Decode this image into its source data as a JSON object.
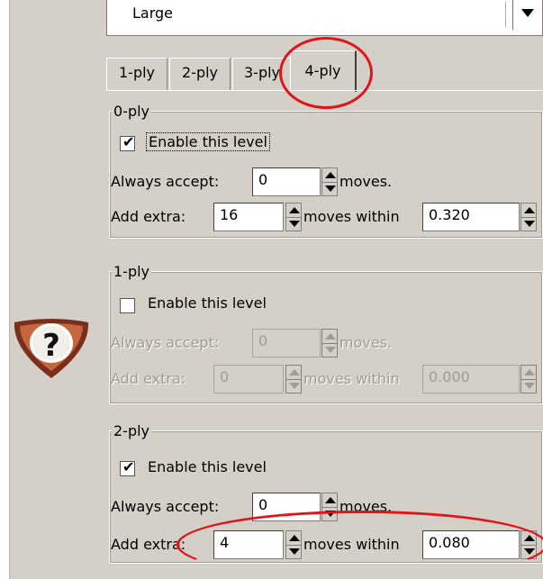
{
  "dropdown": {
    "value": "Large"
  },
  "tabs": [
    "1-ply",
    "2-ply",
    "3-ply",
    "4-ply"
  ],
  "groups": [
    {
      "legend": "0-ply",
      "enable_label": "Enable this level",
      "checked": true,
      "always_label": "Always accept:",
      "always_value": "0",
      "moves_label": "moves.",
      "extra_label": "Add extra:",
      "extra_value": "16",
      "within_label": "moves within",
      "within_value": "0.320"
    },
    {
      "legend": "1-ply",
      "enable_label": "Enable this level",
      "checked": false,
      "always_label": "Always accept:",
      "always_value": "0",
      "moves_label": "moves.",
      "extra_label": "Add extra:",
      "extra_value": "0",
      "within_label": "moves within",
      "within_value": "0.000"
    },
    {
      "legend": "2-ply",
      "enable_label": "Enable this level",
      "checked": true,
      "always_label": "Always accept:",
      "always_value": "0",
      "moves_label": "moves.",
      "extra_label": "Add extra:",
      "extra_value": "4",
      "within_label": "moves within",
      "within_value": "0.080"
    }
  ],
  "help_icon": {
    "symbol": "?",
    "name": "help-icon"
  },
  "checkmark": "✔",
  "annotation_color": "#e0151a"
}
